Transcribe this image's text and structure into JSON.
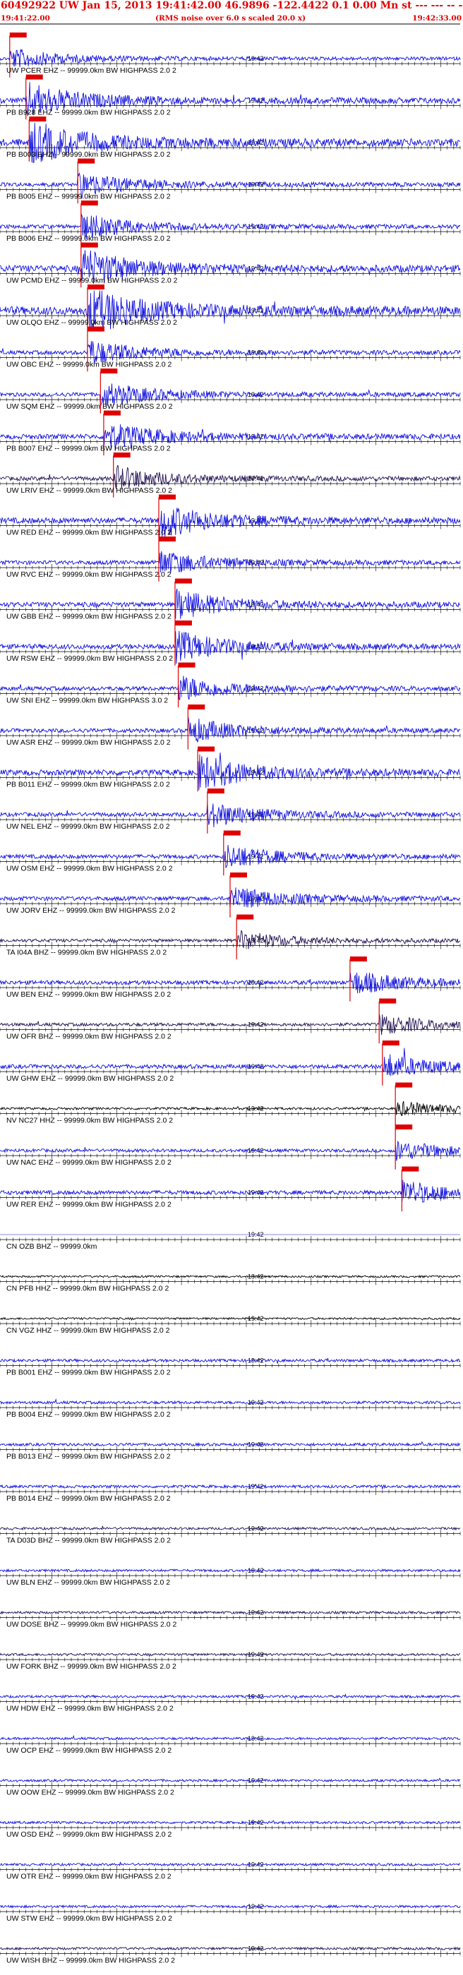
{
  "header": {
    "title": "60492922 UW Jan 15, 2013 19:41:42.00   46.9896 -122.4422  0.1 0.00 Mn st --- --- --  -1",
    "start_time": "19:41:22.00",
    "end_time": "19:42:33.00",
    "note": "(RMS noise over 6.0 s scaled 20.0 x)"
  },
  "colors": {
    "trace": "#1010e0",
    "trace_dark": "#201050",
    "trace_black": "#000000",
    "pick": "#e00000",
    "label": "#000000"
  },
  "chart_data": {
    "type": "line",
    "title": "",
    "x_range_seconds": [
      0,
      71
    ],
    "minute_label": "19:42",
    "minute_tick_seconds": 38,
    "traces": [
      {
        "label": "UW PCER EHZ -- 99999.0km BW  HIGHPASS  2.0  2",
        "pick": 1.5,
        "amp": 0.4,
        "color": "blue"
      },
      {
        "label": "PB B928 EHZ -- 99999.0km BW  HIGHPASS  2.0  2",
        "pick": 4.0,
        "amp": 0.7,
        "color": "blue"
      },
      {
        "label": "PB B003 EHZ -- 99999.0km BW  HIGHPASS  2.0  2",
        "pick": 4.5,
        "amp": 0.9,
        "color": "blue"
      },
      {
        "label": "PB B005 EHZ -- 99999.0km BW  HIGHPASS  2.0  2",
        "pick": 12.0,
        "amp": 0.5,
        "color": "blue"
      },
      {
        "label": "PB B006 EHZ -- 99999.0km BW  HIGHPASS  2.0  2",
        "pick": 12.5,
        "amp": 0.5,
        "color": "blue"
      },
      {
        "label": "UW PCMD EHZ -- 99999.0km BW  HIGHPASS  2.0  2",
        "pick": 12.5,
        "amp": 0.8,
        "color": "blue"
      },
      {
        "label": "UW OLQO EHZ -- 99999.0km BW  HIGHPASS  2.0  2",
        "pick": 13.5,
        "amp": 1.0,
        "color": "blue"
      },
      {
        "label": "UW OBC EHZ -- 99999.0km BW  HIGHPASS  2.0  2",
        "pick": 13.5,
        "amp": 0.5,
        "color": "blue"
      },
      {
        "label": "UW SQM EHZ -- 99999.0km BW  HIGHPASS  2.0  2",
        "pick": 15.5,
        "amp": 0.5,
        "color": "blue"
      },
      {
        "label": "PB B007 EHZ -- 99999.0km BW  HIGHPASS  2.0  2",
        "pick": 16.0,
        "amp": 0.6,
        "color": "blue"
      },
      {
        "label": "UW LRIV EHZ -- 99999.0km BW  HIGHPASS  2.0  2",
        "pick": 17.5,
        "amp": 0.5,
        "color": "dark"
      },
      {
        "label": "UW RED EHZ -- 99999.0km BW  HIGHPASS  2.0  2",
        "pick": 24.5,
        "amp": 0.7,
        "color": "blue"
      },
      {
        "label": "UW RVC EHZ -- 99999.0km BW  HIGHPASS  2.0  2",
        "pick": 24.5,
        "amp": 0.5,
        "color": "blue"
      },
      {
        "label": "UW GBB EHZ -- 99999.0km BW  HIGHPASS  2.0  2",
        "pick": 27.0,
        "amp": 0.6,
        "color": "blue"
      },
      {
        "label": "UW RSW EHZ -- 99999.0km BW  HIGHPASS  2.0  2",
        "pick": 27.0,
        "amp": 0.6,
        "color": "blue"
      },
      {
        "label": "UW SNI EHZ -- 99999.0km BW  HIGHPASS  3.0  2",
        "pick": 27.5,
        "amp": 0.5,
        "color": "blue"
      },
      {
        "label": "UW ASR EHZ -- 99999.0km BW  HIGHPASS  2.0  2",
        "pick": 29.0,
        "amp": 0.5,
        "color": "blue"
      },
      {
        "label": "PB B011 EHZ -- 99999.0km BW  HIGHPASS  2.0  2",
        "pick": 30.5,
        "amp": 0.7,
        "color": "blue"
      },
      {
        "label": "UW NEL EHZ -- 99999.0km BW  HIGHPASS  2.0  2",
        "pick": 32.0,
        "amp": 0.5,
        "color": "blue"
      },
      {
        "label": "UW OSM EHZ -- 99999.0km BW  HIGHPASS  2.0  2",
        "pick": 34.5,
        "amp": 0.5,
        "color": "blue"
      },
      {
        "label": "UW JORV EHZ -- 99999.0km BW  HIGHPASS  2.0  2",
        "pick": 35.5,
        "amp": 0.5,
        "color": "blue"
      },
      {
        "label": "TA I04A BHZ -- 99999.0km BW  HIGHPASS  2.0  2",
        "pick": 36.5,
        "amp": 0.4,
        "color": "dark"
      },
      {
        "label": "UW BEN EHZ -- 99999.0km BW  HIGHPASS  2.0  2",
        "pick": 54.0,
        "amp": 0.5,
        "color": "blue"
      },
      {
        "label": "UW OFR BHZ -- 99999.0km BW  HIGHPASS  2.0  2",
        "pick": 58.5,
        "amp": 0.4,
        "color": "dark"
      },
      {
        "label": "UW GHW EHZ -- 99999.0km BW  HIGHPASS  2.0  2",
        "pick": 59.0,
        "amp": 0.5,
        "color": "blue"
      },
      {
        "label": "NV NC27 HHZ -- 99999.0km BW  HIGHPASS  2.0  2",
        "pick": 61.0,
        "amp": 0.3,
        "color": "black"
      },
      {
        "label": "UW NAC EHZ -- 99999.0km BW  HIGHPASS  2.0  2",
        "pick": 61.0,
        "amp": 0.4,
        "color": "blue"
      },
      {
        "label": "UW RER EHZ -- 99999.0km BW  HIGHPASS  2.0  2",
        "pick": 62.0,
        "amp": 0.5,
        "color": "blue"
      },
      {
        "label": "CN OZB BHZ -- 99999.0km",
        "pick": null,
        "amp": 0.0,
        "color": "blue"
      },
      {
        "label": "CN PFB HHZ -- 99999.0km BW  HIGHPASS  2.0  2",
        "pick": null,
        "amp": 0.25,
        "color": "black"
      },
      {
        "label": "CN VGZ HHZ -- 99999.0km BW  HIGHPASS  2.0  2",
        "pick": null,
        "amp": 0.25,
        "color": "black"
      },
      {
        "label": "PB B001 EHZ -- 99999.0km BW  HIGHPASS  2.0  2",
        "pick": null,
        "amp": 0.35,
        "color": "blue"
      },
      {
        "label": "PB B004 EHZ -- 99999.0km BW  HIGHPASS  2.0  2",
        "pick": null,
        "amp": 0.35,
        "color": "blue"
      },
      {
        "label": "PB B013 EHZ -- 99999.0km BW  HIGHPASS  2.0  2",
        "pick": null,
        "amp": 0.35,
        "color": "blue"
      },
      {
        "label": "PB B014 EHZ -- 99999.0km BW  HIGHPASS  2.0  2",
        "pick": null,
        "amp": 0.35,
        "color": "blue"
      },
      {
        "label": "TA D03D BHZ -- 99999.0km BW  HIGHPASS  2.0  2",
        "pick": null,
        "amp": 0.3,
        "color": "dark"
      },
      {
        "label": "UW BLN EHZ -- 99999.0km BW  HIGHPASS  2.0  2",
        "pick": null,
        "amp": 0.3,
        "color": "blue"
      },
      {
        "label": "UW DOSE BHZ -- 99999.0km BW  HIGHPASS  2.0  2",
        "pick": null,
        "amp": 0.3,
        "color": "dark"
      },
      {
        "label": "UW FORK BHZ -- 99999.0km BW  HIGHPASS  2.0  2",
        "pick": null,
        "amp": 0.3,
        "color": "dark"
      },
      {
        "label": "UW HDW EHZ -- 99999.0km BW  HIGHPASS  2.0  2",
        "pick": null,
        "amp": 0.3,
        "color": "blue"
      },
      {
        "label": "UW OCP EHZ -- 99999.0km BW  HIGHPASS  2.0  2",
        "pick": null,
        "amp": 0.3,
        "color": "blue"
      },
      {
        "label": "UW OOW EHZ -- 99999.0km BW  HIGHPASS  2.0  2",
        "pick": null,
        "amp": 0.3,
        "color": "blue"
      },
      {
        "label": "UW OSD EHZ -- 99999.0km BW  HIGHPASS  2.0  2",
        "pick": null,
        "amp": 0.3,
        "color": "blue"
      },
      {
        "label": "UW OTR EHZ -- 99999.0km BW  HIGHPASS  2.0  2",
        "pick": null,
        "amp": 0.3,
        "color": "blue"
      },
      {
        "label": "UW STW EHZ -- 99999.0km BW  HIGHPASS  2.0  2",
        "pick": null,
        "amp": 0.3,
        "color": "blue"
      },
      {
        "label": "UW WISH BHZ -- 99999.0km BW  HIGHPASS  2.0  2",
        "pick": null,
        "amp": 0.3,
        "color": "dark"
      }
    ]
  }
}
